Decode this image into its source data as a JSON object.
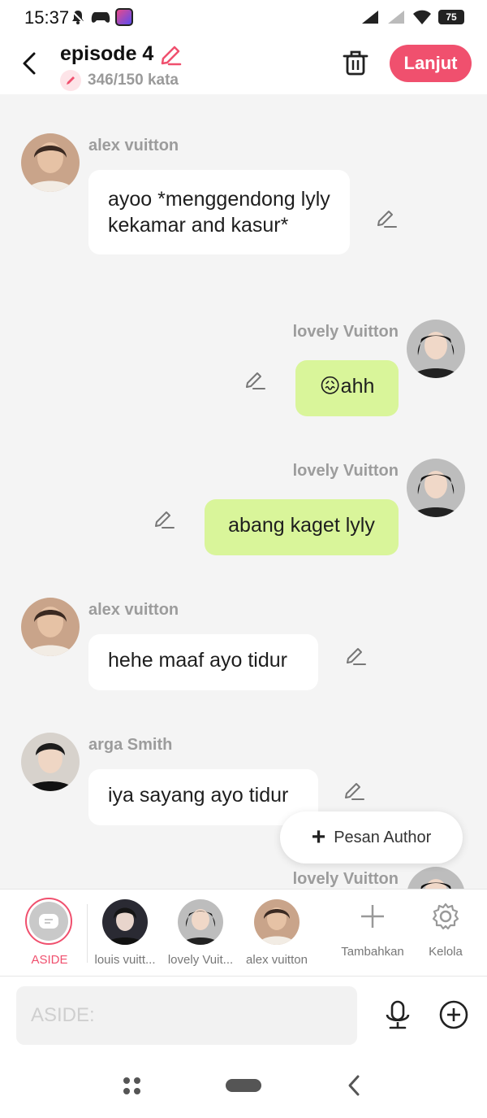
{
  "status_bar": {
    "time": "15:37",
    "battery": "75"
  },
  "header": {
    "title": "episode 4",
    "word_count": "346/150 kata",
    "next_button": "Lanjut"
  },
  "messages": [
    {
      "name": "alex vuitton",
      "text": "ayoo *menggendong lyly kekamar and kasur*",
      "side": "left"
    },
    {
      "name": "lovely Vuitton",
      "text": "😖ahh",
      "side": "right"
    },
    {
      "name": "lovely Vuitton",
      "text": "abang kaget lyly",
      "side": "right"
    },
    {
      "name": "alex vuitton",
      "text": "hehe maaf ayo tidur",
      "side": "left"
    },
    {
      "name": "arga Smith",
      "text": "iya sayang ayo tidur",
      "side": "left"
    },
    {
      "name": "lovely Vuitton",
      "text": "",
      "side": "right"
    }
  ],
  "fab": {
    "label": "Pesan Author"
  },
  "characters": [
    {
      "label": "ASIDE"
    },
    {
      "label": "louis vuitt..."
    },
    {
      "label": "lovely Vuit..."
    },
    {
      "label": "alex vuitton"
    }
  ],
  "actions": {
    "add_label": "Tambahkan",
    "manage_label": "Kelola"
  },
  "input": {
    "placeholder": "ASIDE:"
  },
  "colors": {
    "accent": "#f0506e",
    "right_bubble": "#d9f59a",
    "left_bubble": "#ffffff",
    "background": "#f4f4f4"
  },
  "icons": [
    "back-arrow-icon",
    "pencil-icon",
    "trash-icon",
    "edit-icon",
    "plus-icon",
    "gear-icon",
    "mic-icon",
    "add-circle-icon"
  ]
}
